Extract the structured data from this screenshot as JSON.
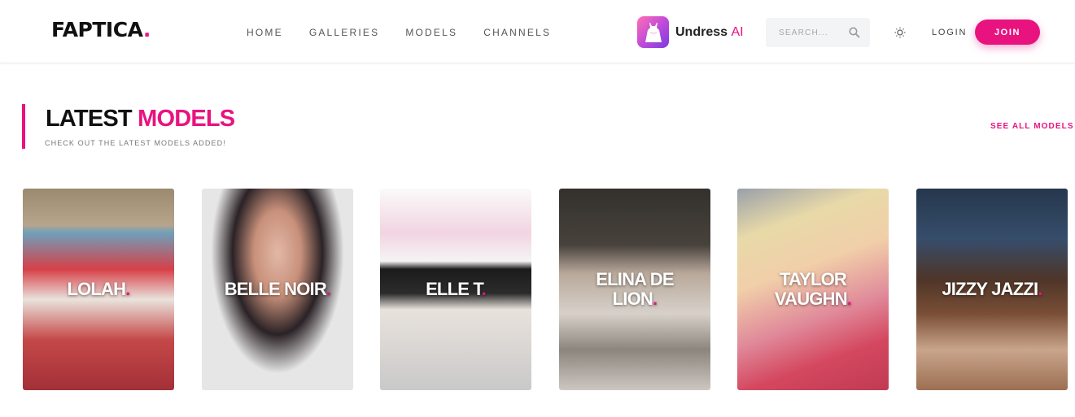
{
  "header": {
    "logo_text": "FAPTICA",
    "logo_dot": ".",
    "nav": [
      "HOME",
      "GALLERIES",
      "MODELS",
      "CHANNELS"
    ],
    "promo": {
      "name": "Undress",
      "suffix": "AI",
      "icon": "dress-icon"
    },
    "search": {
      "placeholder": "SEARCH...",
      "icon": "search-icon"
    },
    "theme_icon": "sun-icon",
    "login_label": "LOGIN",
    "join_label": "JOIN"
  },
  "section": {
    "title_a": "LATEST",
    "title_b": "MODELS",
    "subtitle": "CHECK OUT THE LATEST MODELS ADDED!",
    "see_all": "SEE ALL MODELS"
  },
  "models": [
    {
      "name": "LOLAH"
    },
    {
      "name": "BELLE NOIR"
    },
    {
      "name": "ELLE T"
    },
    {
      "name": "ELINA DE LION"
    },
    {
      "name": "TAYLOR VAUGHN"
    },
    {
      "name": "JIZZY JAZZI"
    }
  ],
  "colors": {
    "accent": "#e8137f",
    "text": "#111111"
  }
}
